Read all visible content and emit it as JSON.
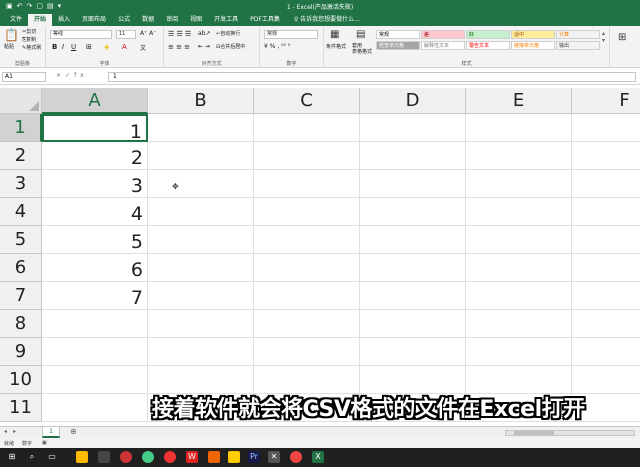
{
  "window": {
    "title": "1 - Excel(产品激活失败)",
    "qat_icons": [
      "save-icon",
      "undo-icon",
      "redo-icon",
      "new-icon",
      "open-icon",
      "customize-icon"
    ]
  },
  "ribbon": {
    "tabs": [
      {
        "label": "文件",
        "active": false
      },
      {
        "label": "开始",
        "active": true
      },
      {
        "label": "插入",
        "active": false
      },
      {
        "label": "页面布局",
        "active": false
      },
      {
        "label": "公式",
        "active": false
      },
      {
        "label": "数据",
        "active": false
      },
      {
        "label": "审阅",
        "active": false
      },
      {
        "label": "视图",
        "active": false
      },
      {
        "label": "开发工具",
        "active": false
      },
      {
        "label": "PDF工具集",
        "active": false
      }
    ],
    "tell_me": "告诉我您想要做什么...",
    "clipboard": {
      "paste": "粘贴",
      "cut": "剪切",
      "copy": "复制",
      "format_painter": "格式刷",
      "group": "剪贴板"
    },
    "font": {
      "name": "等线",
      "size": "11",
      "group": "字体"
    },
    "alignment": {
      "wrap": "自动换行",
      "merge": "合并后居中",
      "group": "对齐方式"
    },
    "number": {
      "format": "常规",
      "group": "数字"
    },
    "styles": {
      "conditional": "条件格式",
      "table": "套用\n表格格式",
      "group": "样式",
      "cells": [
        {
          "label": "常规",
          "bg": "#ffffff",
          "fg": "#000000"
        },
        {
          "label": "差",
          "bg": "#ffc7ce",
          "fg": "#9c0006"
        },
        {
          "label": "好",
          "bg": "#c6efce",
          "fg": "#006100"
        },
        {
          "label": "适中",
          "bg": "#ffeb9c",
          "fg": "#9c5700"
        },
        {
          "label": "计算",
          "bg": "#f2f2f2",
          "fg": "#fa7d00"
        },
        {
          "label": "检查单元格",
          "bg": "#a5a5a5",
          "fg": "#ffffff"
        },
        {
          "label": "解释性文本",
          "bg": "#ffffff",
          "fg": "#7f7f7f"
        },
        {
          "label": "警告文本",
          "bg": "#ffffff",
          "fg": "#ff0000"
        },
        {
          "label": "链接单元格",
          "bg": "#ffffff",
          "fg": "#fa7d00"
        },
        {
          "label": "输出",
          "bg": "#f2f2f2",
          "fg": "#3f3f3f"
        }
      ]
    }
  },
  "formula_bar": {
    "name_box": "A1",
    "value": "1"
  },
  "sheet": {
    "columns": [
      "A",
      "B",
      "C",
      "D",
      "E",
      "F"
    ],
    "rows": [
      "1",
      "2",
      "3",
      "4",
      "5",
      "6",
      "7",
      "8",
      "9",
      "10",
      "11"
    ],
    "col_a_values": [
      "1",
      "2",
      "3",
      "4",
      "5",
      "6",
      "7",
      "",
      "",
      "",
      ""
    ],
    "active_cell": "A1"
  },
  "sheet_tabs": {
    "tabs": [
      "1"
    ],
    "active": "1"
  },
  "status": {
    "ready": "就绪",
    "numlock": "数字"
  },
  "subtitle": "接着软件就会将CSV格式的文件在Excel打开",
  "colors": {
    "accent": "#217346",
    "taskbar": "#202020"
  }
}
